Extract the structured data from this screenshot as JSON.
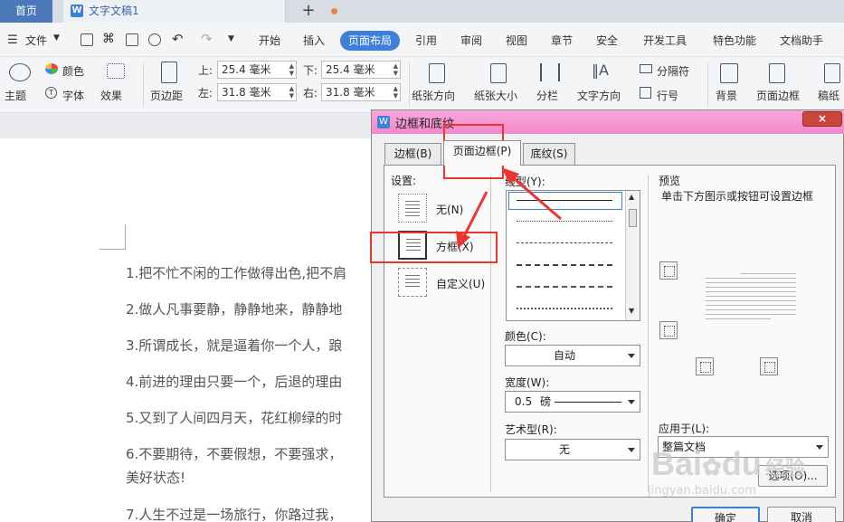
{
  "titlebar": {
    "home_tab": "首页",
    "doc_tab_title": "文字文稿1",
    "add_tab": "+"
  },
  "menubar": {
    "file_label": "文件",
    "tabs": [
      "开始",
      "插入",
      "页面布局",
      "引用",
      "审阅",
      "视图",
      "章节",
      "安全",
      "开发工具",
      "特色功能",
      "文档助手"
    ],
    "active_tab": "页面布局"
  },
  "ribbon": {
    "theme_label": "主题",
    "color_label": "颜色",
    "font_label": "字体",
    "effect_label": "效果",
    "margin_label": "页边距",
    "top_label": "上:",
    "top_value": "25.4 毫米",
    "bottom_label": "下:",
    "bottom_value": "25.4 毫米",
    "left_label": "左:",
    "left_value": "31.8 毫米",
    "right_label": "右:",
    "right_value": "31.8 毫米",
    "orientation_label": "纸张方向",
    "size_label": "纸张大小",
    "columns_label": "分栏",
    "text_direction_label": "文字方向",
    "separator_label": "分隔符",
    "line_number_label": "行号",
    "background_label": "背景",
    "page_border_label": "页面边框",
    "paper_label": "稿纸"
  },
  "document": {
    "lines": [
      "1.把不忙不闲的工作做得出色,把不肩",
      "2.做人凡事要静，静静地来，静静地",
      "3.所谓成长，就是逼着你一个人，踉",
      "4.前进的理由只要一个，后退的理由",
      "5.又到了人间四月天，花红柳绿的时",
      "6.不要期待，不要假想，不要强求，",
      "美好状态!",
      "7.人生不过是一场旅行，你路过我，"
    ]
  },
  "dialog": {
    "title": "边框和底纹",
    "close": "×",
    "tabs": [
      "边框(B)",
      "页面边框(P)",
      "底纹(S)"
    ],
    "active_tab": "页面边框(P)",
    "settings_label": "设置:",
    "presets": [
      "无(N)",
      "方框(X)",
      "自定义(U)"
    ],
    "line_style_label": "线型(Y):",
    "color_label": "颜色(C):",
    "color_value": "自动",
    "width_label": "宽度(W):",
    "width_value": "0.5",
    "width_unit": "磅",
    "art_label": "艺术型(R):",
    "art_value": "无",
    "preview_label": "预览",
    "preview_hint": "单击下方图示或按钮可设置边框",
    "apply_label": "应用于(L):",
    "apply_value": "整篇文档",
    "options_button": "选项(O)...",
    "ok_button": "确定",
    "cancel_button": "取消"
  },
  "watermark": {
    "brand": "Bai",
    "brand2": "du",
    "brand_cn": "经验",
    "url": "jingyan.baidu.com"
  },
  "colors": {
    "accent": "#3d7fd9",
    "annotation": "#ee3333",
    "dialog_title": "#f288cc"
  }
}
